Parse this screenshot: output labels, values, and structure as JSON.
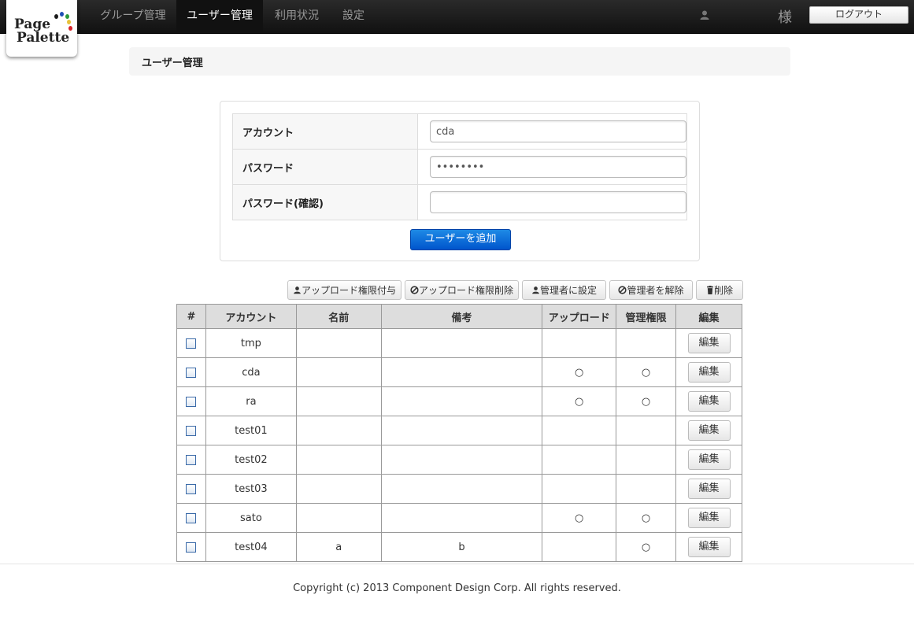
{
  "app": {
    "logo_line1": "Page",
    "logo_line2": "Palette",
    "logo_dot_colors": [
      "#1a1a1a",
      "#1f4fb5",
      "#2a9a3a",
      "#e8c23a",
      "#d8232a"
    ]
  },
  "nav": {
    "items": [
      {
        "label": "グループ管理",
        "active": false
      },
      {
        "label": "ユーザー管理",
        "active": true
      },
      {
        "label": "利用状況",
        "active": false
      },
      {
        "label": "設定",
        "active": false
      }
    ],
    "user_icon": "user-icon",
    "user_suffix": "様",
    "logout_label": "ログアウト"
  },
  "page": {
    "title": "ユーザー管理"
  },
  "form": {
    "account_label": "アカウント",
    "account_value": "cda",
    "password_label": "パスワード",
    "password_value": "********",
    "password_confirm_label": "パスワード(確認)",
    "password_confirm_value": "",
    "submit_label": "ユーザーを追加"
  },
  "toolbar": {
    "grant_upload": {
      "icon": "user-icon",
      "label": "アップロード権限付与"
    },
    "revoke_upload": {
      "icon": "ban-icon",
      "label": "アップロード権限削除"
    },
    "set_admin": {
      "icon": "user-icon",
      "label": "管理者に設定"
    },
    "unset_admin": {
      "icon": "ban-icon",
      "label": "管理者を解除"
    },
    "delete": {
      "icon": "trash-icon",
      "label": "削除"
    }
  },
  "table": {
    "headers": [
      "#",
      "アカウント",
      "名前",
      "備考",
      "アップロード",
      "管理権限",
      "編集"
    ],
    "edit_label": "編集",
    "rows": [
      {
        "account": "tmp",
        "name": "",
        "note": "",
        "upload": "",
        "admin": ""
      },
      {
        "account": "cda",
        "name": "",
        "note": "",
        "upload": "○",
        "admin": "○"
      },
      {
        "account": "ra",
        "name": "",
        "note": "",
        "upload": "○",
        "admin": "○"
      },
      {
        "account": "test01",
        "name": "",
        "note": "",
        "upload": "",
        "admin": ""
      },
      {
        "account": "test02",
        "name": "",
        "note": "",
        "upload": "",
        "admin": ""
      },
      {
        "account": "test03",
        "name": "",
        "note": "",
        "upload": "",
        "admin": ""
      },
      {
        "account": "sato",
        "name": "",
        "note": "",
        "upload": "○",
        "admin": "○"
      },
      {
        "account": "test04",
        "name": "a",
        "note": "b",
        "upload": "",
        "admin": "○"
      }
    ]
  },
  "footer": {
    "copyright": "Copyright (c) 2013 Component Design Corp. All rights reserved."
  }
}
